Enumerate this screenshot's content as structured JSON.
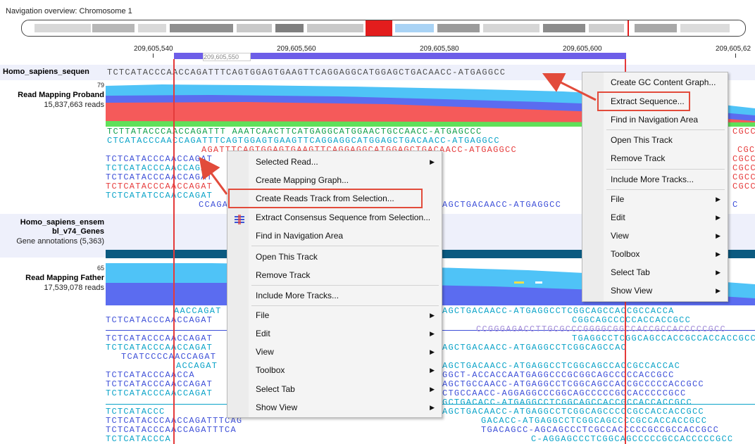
{
  "navigation": {
    "title": "Navigation overview: Chromosome 1"
  },
  "ruler": {
    "labels": [
      "209,605,540",
      "209,605,560",
      "209,605,580",
      "209,605,600",
      "209,605,62"
    ],
    "selection_label": "209,605,550"
  },
  "reference": {
    "label": "Homo_sapiens_sequen",
    "sequence": "TCTCATACCCAACCAGATTTCAGTGGAGTGAAGTTCAGGAGGCATGGAGCTGACAACC-ATGAGGCC"
  },
  "proband": {
    "coverage_max": "79",
    "label": "Read Mapping Proband",
    "reads": "15,837,663 reads",
    "rows": [
      "TCTTATACCCAACCAGATTT      AAATCAACTTCATGAGGCATGGAACTGCCAACC-ATGAGCCC",
      "CTCATACCCAACCAGATTTCAGTGGAGTGAAGTTCAGGAGGCATGGAGCTGACAACC-ATGAGGCC",
      "AGATTTCAGTGGAGTGAAGTTCAGGAGGCATGGAGCTGACAACC-ATGAGGCC",
      "TCTCATACCCAACCAGAT",
      "TCTCATACCCAACCAGAT",
      "TCTCATACCCAACCAGAT",
      "TCTCATACCCAACCAGAT",
      "TCTCATATCCAACCAGAT",
      "CCAGAT"
    ],
    "right_rows": [
      "CGCC",
      "CGC",
      "CGCC",
      "CGCC",
      "CGCC",
      "CGCC",
      "C"
    ]
  },
  "genes": {
    "label_line1": "Homo_sapiens_ensem",
    "label_line2": "bl_v74_Genes",
    "sub": "Gene annotations (5,363)"
  },
  "father": {
    "coverage_max": "65",
    "label": "Read Mapping Father",
    "reads": "17,539,078 reads",
    "left_rows": [
      "AACCAGAT",
      "TCTCATACCCAACCAGAT",
      "",
      "TCTCATACCCAACCAGAT",
      "TCTCATACCCAACCAGAT",
      "TCATCCCCAACCAGAT",
      "ACCAGAT",
      "TCTCATACCCAACCA",
      "TCTCATACCCAACCAGAT",
      "TCTCATACCCAACCAGAT",
      "",
      "TCTCATACCC",
      "TCTCATACCCAACCAGATTTCAG",
      "TCTCATACCCAACCAGATTTCA",
      "TCTCATACCCA"
    ],
    "right_rows": [
      "AGCTGACAACC-ATGAGGCCTCGGCAGCCACCGCCACCA",
      "CGGCAGCCCCCACCACCGCC",
      "CCGGGAGACCTTGCGCCCGGGGCGGCCACCGCCACCCCCGCC",
      "TGAGGCCTCGGCAGCCACCGCCACCACCGCC",
      "AGCTGACAACC-ATGAGGCCTCGGCAGCCAC",
      "AGCTGACAACC-ATGAGGCCTCGGCAGCCACCGCCACCAC",
      "GGCT-ACCACCAATGAGGCCCGCGGCAGCCCCCACCGCC",
      "AGCTGCCAACC-ATGAGGCCTCGGCAGCCACCGCCCCCACCGCC",
      "CTGCCAACC-AGGAGGCCCGGCAGCCCCCGCCACCCCCGCC",
      "GCTGACACC-ATGAGGCCTCGGCAGCCACCGCCACCACCGCC",
      "AGCTGACAACC-ATGAGGCCTCGGCAGCCCCCGCCACCACCGCC",
      "GACACC-ATGAGGCCTCGGCAGCCCCGCCACCACCGCC",
      "TGACAGCC-AGCAGCCCTCGCCACCCCCGCCGCCACCGCC",
      "C-AGGAGCCCTCGGCAGCCCCCGCCACCCCCGCC"
    ]
  },
  "main_context_menu": {
    "items": [
      {
        "label": "Selected Read...",
        "submenu": true
      },
      {
        "label": "Create Mapping Graph...",
        "submenu": false
      },
      {
        "label": "Create Reads Track from Selection...",
        "submenu": false
      },
      {
        "label": "Extract Consensus Sequence from Selection...",
        "submenu": false
      },
      {
        "label": "Find in Navigation Area",
        "submenu": false
      },
      {
        "label": "Open This Track",
        "submenu": false
      },
      {
        "label": "Remove Track",
        "submenu": false
      },
      {
        "label": "Include More Tracks...",
        "submenu": false
      },
      {
        "label": "File",
        "submenu": true
      },
      {
        "label": "Edit",
        "submenu": true
      },
      {
        "label": "View",
        "submenu": true
      },
      {
        "label": "Toolbox",
        "submenu": true
      },
      {
        "label": "Select Tab",
        "submenu": true
      },
      {
        "label": "Show View",
        "submenu": true
      }
    ]
  },
  "reference_context_menu": {
    "items": [
      {
        "label": "Create GC Content Graph...",
        "submenu": false
      },
      {
        "label": "Extract Sequence...",
        "submenu": false
      },
      {
        "label": "Find in Navigation Area",
        "submenu": false
      },
      {
        "label": "Open This Track",
        "submenu": false
      },
      {
        "label": "Remove Track",
        "submenu": false
      },
      {
        "label": "Include More Tracks...",
        "submenu": false
      },
      {
        "label": "File",
        "submenu": true
      },
      {
        "label": "Edit",
        "submenu": true
      },
      {
        "label": "View",
        "submenu": true
      },
      {
        "label": "Toolbox",
        "submenu": true
      },
      {
        "label": "Select Tab",
        "submenu": true
      },
      {
        "label": "Show View",
        "submenu": true
      }
    ]
  },
  "colors": {
    "selection": "#e43a3a",
    "highlight_box": "#e24b3b",
    "coverage_top": "#4fc3f7",
    "coverage_mid": "#5b6cf0",
    "coverage_bottom": "#f55a5a",
    "gene_bar": "#0b5a80",
    "forward_read": "#0aa3c8",
    "reverse_read": "#3d4fd8"
  }
}
